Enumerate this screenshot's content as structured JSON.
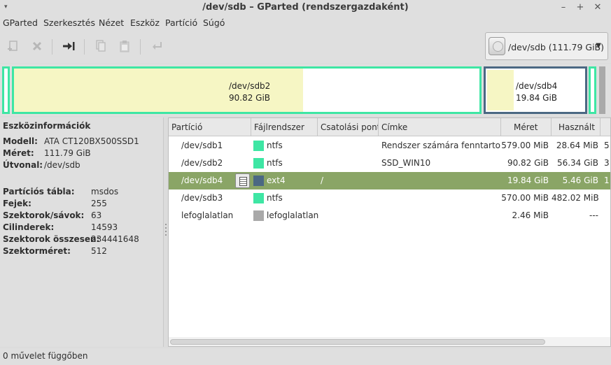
{
  "window": {
    "title": "/dev/sdb – GParted (rendszergazdaként)",
    "menu_glyph": "▾",
    "minimize_glyph": "–",
    "maximize_glyph": "+",
    "close_glyph": "✕"
  },
  "menu": [
    "GParted",
    "Szerkesztés",
    "Nézet",
    "Eszköz",
    "Partíció",
    "Súgó"
  ],
  "toolbar": {
    "icons": [
      "new-partition-icon",
      "delete-icon",
      "resize-move-icon",
      "copy-icon",
      "paste-icon",
      "undo-icon"
    ],
    "device_selector": "/dev/sdb   (111.79 GiB)"
  },
  "disk_map": [
    {
      "name": "/dev/sdb2",
      "size": "90.82 GiB"
    },
    {
      "name": "/dev/sdb4",
      "size": "19.84 GiB"
    }
  ],
  "device_info": {
    "header": "Eszközinformációk",
    "rows": [
      {
        "key": "Modell:",
        "value": "ATA CT120BX500SSD1"
      },
      {
        "key": "Méret:",
        "value": "111.79 GiB"
      },
      {
        "key": "Útvonal:",
        "value": "/dev/sdb"
      },
      {
        "key": "Partíciós tábla:",
        "value": "msdos"
      },
      {
        "key": "Fejek:",
        "value": "255"
      },
      {
        "key": "Szektorok/sávok:",
        "value": "63"
      },
      {
        "key": "Cilinderek:",
        "value": "14593"
      },
      {
        "key": "Szektorok összesen:",
        "value": "234441648"
      },
      {
        "key": "Szektorméret:",
        "value": "512"
      }
    ]
  },
  "table": {
    "columns": [
      "Partíció",
      "Fájlrendszer",
      "Csatolási pont",
      "Címke",
      "Méret",
      "Használt"
    ],
    "rows": [
      {
        "partition": "/dev/sdb1",
        "filesystem": "ntfs",
        "mount": "",
        "label": "Rendszer számára fenntartott",
        "size": "579.00 MiB",
        "used": "28.64 MiB",
        "trailing": "5",
        "color": "#3ee6a4"
      },
      {
        "partition": "/dev/sdb2",
        "filesystem": "ntfs",
        "mount": "",
        "label": "SSD_WIN10",
        "size": "90.82 GiB",
        "used": "56.34 GiB",
        "trailing": "3",
        "color": "#3ee6a4"
      },
      {
        "partition": "/dev/sdb4",
        "filesystem": "ext4",
        "mount": "/",
        "label": "",
        "size": "19.84 GiB",
        "used": "5.46 GiB",
        "trailing": "1",
        "color": "#4b6883",
        "selected": true
      },
      {
        "partition": "/dev/sdb3",
        "filesystem": "ntfs",
        "mount": "",
        "label": "",
        "size": "570.00 MiB",
        "used": "482.02 MiB",
        "trailing": "",
        "color": "#3ee6a4"
      },
      {
        "partition": "lefoglalatlan",
        "filesystem": "lefoglalatlan",
        "mount": "",
        "label": "",
        "size": "2.46 MiB",
        "used": "---",
        "trailing": "",
        "color": "#a9a9a9"
      }
    ]
  },
  "status": "0 művelet függőben"
}
